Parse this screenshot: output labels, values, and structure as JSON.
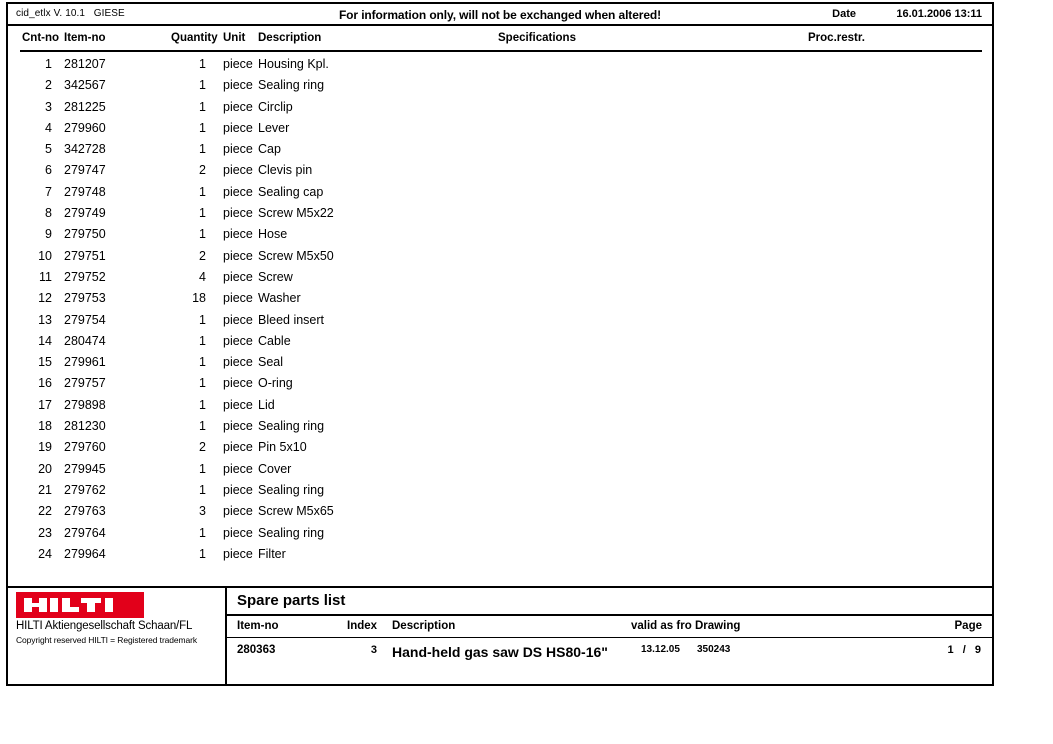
{
  "header": {
    "left_text": "cid_etlx V. 10.1   GIESE",
    "notice": "For information only, will not be exchanged when altered!",
    "date_label": "Date",
    "date_value": "16.01.2006 13:11"
  },
  "table": {
    "columns": {
      "cnt_no": "Cnt-no",
      "item_no": "Item-no",
      "quantity": "Quantity",
      "unit": "Unit",
      "description": "Description",
      "specifications": "Specifications",
      "proc_restr": "Proc.restr."
    },
    "rows": [
      {
        "cnt": "1",
        "item": "281207",
        "qty": "1",
        "unit": "piece",
        "desc": "Housing Kpl.",
        "spec": "",
        "proc": ""
      },
      {
        "cnt": "2",
        "item": "342567",
        "qty": "1",
        "unit": "piece",
        "desc": "Sealing ring",
        "spec": "",
        "proc": ""
      },
      {
        "cnt": "3",
        "item": "281225",
        "qty": "1",
        "unit": "piece",
        "desc": "Circlip",
        "spec": "",
        "proc": ""
      },
      {
        "cnt": "4",
        "item": "279960",
        "qty": "1",
        "unit": "piece",
        "desc": "Lever",
        "spec": "",
        "proc": ""
      },
      {
        "cnt": "5",
        "item": "342728",
        "qty": "1",
        "unit": "piece",
        "desc": "Cap",
        "spec": "",
        "proc": ""
      },
      {
        "cnt": "6",
        "item": "279747",
        "qty": "2",
        "unit": "piece",
        "desc": "Clevis pin",
        "spec": "",
        "proc": ""
      },
      {
        "cnt": "7",
        "item": "279748",
        "qty": "1",
        "unit": "piece",
        "desc": "Sealing cap",
        "spec": "",
        "proc": ""
      },
      {
        "cnt": "8",
        "item": "279749",
        "qty": "1",
        "unit": "piece",
        "desc": "Screw M5x22",
        "spec": "",
        "proc": ""
      },
      {
        "cnt": "9",
        "item": "279750",
        "qty": "1",
        "unit": "piece",
        "desc": "Hose",
        "spec": "",
        "proc": ""
      },
      {
        "cnt": "10",
        "item": "279751",
        "qty": "2",
        "unit": "piece",
        "desc": "Screw M5x50",
        "spec": "",
        "proc": ""
      },
      {
        "cnt": "11",
        "item": "279752",
        "qty": "4",
        "unit": "piece",
        "desc": "Screw",
        "spec": "",
        "proc": ""
      },
      {
        "cnt": "12",
        "item": "279753",
        "qty": "18",
        "unit": "piece",
        "desc": "Washer",
        "spec": "",
        "proc": ""
      },
      {
        "cnt": "13",
        "item": "279754",
        "qty": "1",
        "unit": "piece",
        "desc": "Bleed insert",
        "spec": "",
        "proc": ""
      },
      {
        "cnt": "14",
        "item": "280474",
        "qty": "1",
        "unit": "piece",
        "desc": "Cable",
        "spec": "",
        "proc": ""
      },
      {
        "cnt": "15",
        "item": "279961",
        "qty": "1",
        "unit": "piece",
        "desc": "Seal",
        "spec": "",
        "proc": ""
      },
      {
        "cnt": "16",
        "item": "279757",
        "qty": "1",
        "unit": "piece",
        "desc": "O-ring",
        "spec": "",
        "proc": ""
      },
      {
        "cnt": "17",
        "item": "279898",
        "qty": "1",
        "unit": "piece",
        "desc": "Lid",
        "spec": "",
        "proc": ""
      },
      {
        "cnt": "18",
        "item": "281230",
        "qty": "1",
        "unit": "piece",
        "desc": "Sealing ring",
        "spec": "",
        "proc": ""
      },
      {
        "cnt": "19",
        "item": "279760",
        "qty": "2",
        "unit": "piece",
        "desc": "Pin 5x10",
        "spec": "",
        "proc": ""
      },
      {
        "cnt": "20",
        "item": "279945",
        "qty": "1",
        "unit": "piece",
        "desc": "Cover",
        "spec": "",
        "proc": ""
      },
      {
        "cnt": "21",
        "item": "279762",
        "qty": "1",
        "unit": "piece",
        "desc": "Sealing ring",
        "spec": "",
        "proc": ""
      },
      {
        "cnt": "22",
        "item": "279763",
        "qty": "3",
        "unit": "piece",
        "desc": "Screw M5x65",
        "spec": "",
        "proc": ""
      },
      {
        "cnt": "23",
        "item": "279764",
        "qty": "1",
        "unit": "piece",
        "desc": "Sealing ring",
        "spec": "",
        "proc": ""
      },
      {
        "cnt": "24",
        "item": "279964",
        "qty": "1",
        "unit": "piece",
        "desc": "Filter",
        "spec": "",
        "proc": ""
      }
    ]
  },
  "footer": {
    "logo_text": "HILTI",
    "logo_color": "#e2001a",
    "company": "HILTI Aktiengesellschaft Schaan/FL",
    "copyright": "Copyright reserved HILTI = Registered trademark",
    "title": "Spare parts list",
    "columns": {
      "item_no": "Item-no",
      "index": "Index",
      "description": "Description",
      "valid_as_from": "valid as fro",
      "drawing": "Drawing",
      "page": "Page"
    },
    "values": {
      "item_no": "280363",
      "index": "3",
      "description": "Hand-held gas saw DS HS80-16\"",
      "valid_as_from": "13.12.05",
      "drawing": "350243",
      "page": "1  /  9"
    }
  }
}
